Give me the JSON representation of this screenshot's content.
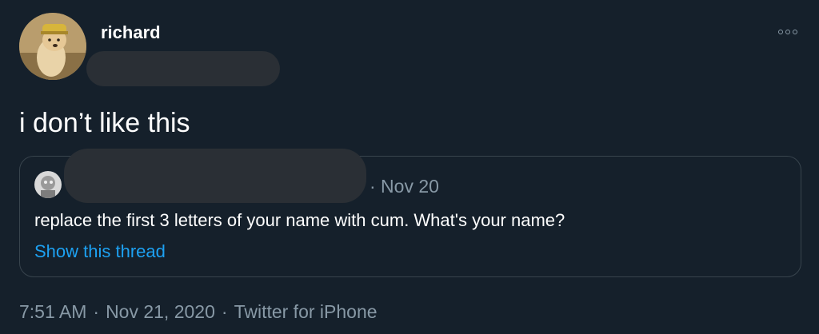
{
  "tweet": {
    "display_name": "richard",
    "text": "i don’t like this",
    "time": "7:51 AM",
    "date": "Nov 21, 2020",
    "source": "Twitter for iPhone",
    "separator": "·"
  },
  "quote": {
    "date": "· Nov 20",
    "text": "replace the first 3 letters of your name with cum. What's your name?",
    "link_label": "Show this thread"
  },
  "icons": {
    "more": "more-options-icon",
    "avatar": "avatar-dog-with-hat",
    "quote_avatar": "quote-avatar-gray"
  },
  "colors": {
    "background": "#15202b",
    "muted_text": "#8899a6",
    "link": "#1da1f2",
    "border": "#38444d"
  }
}
